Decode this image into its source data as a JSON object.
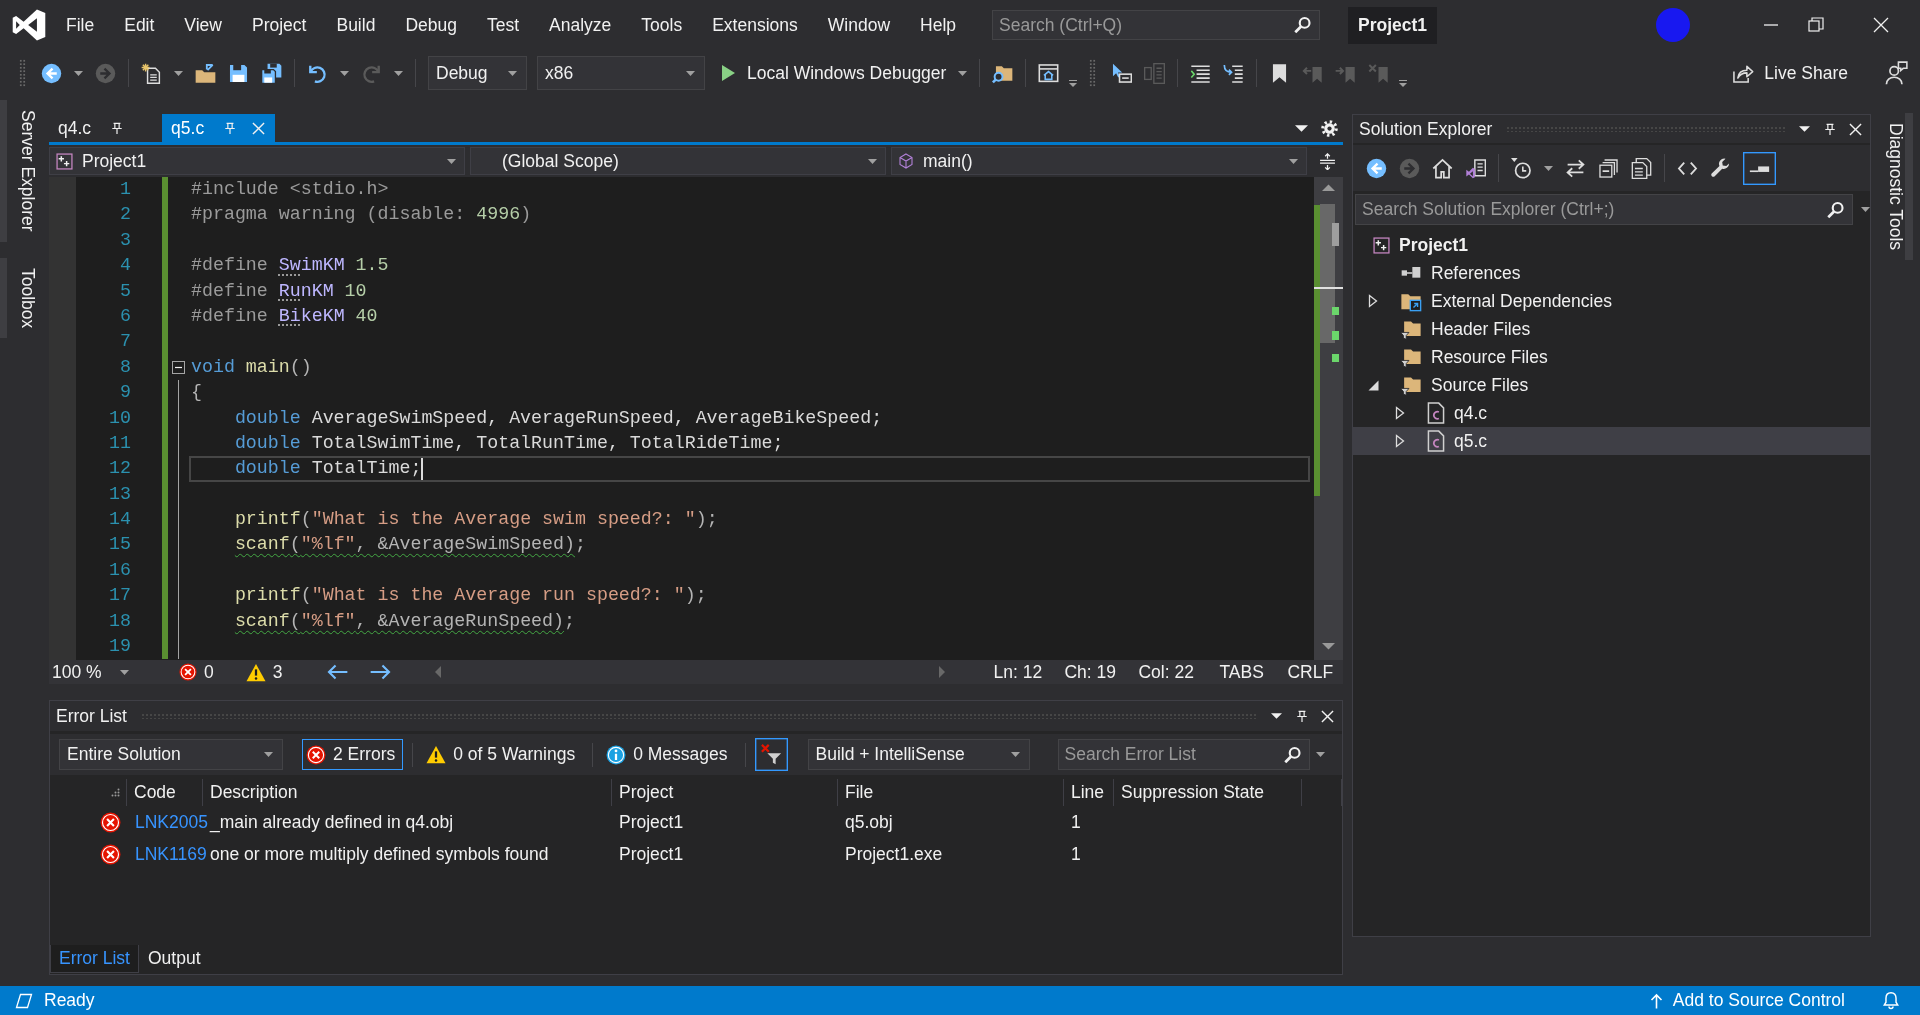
{
  "window": {
    "title": "Project1"
  },
  "menu": [
    "File",
    "Edit",
    "View",
    "Project",
    "Build",
    "Debug",
    "Test",
    "Analyze",
    "Tools",
    "Extensions",
    "Window",
    "Help"
  ],
  "search": {
    "placeholder": "Search (Ctrl+Q)"
  },
  "toolbar": {
    "groups": [
      [
        {
          "kind": "back",
          "disabled": false
        },
        {
          "kind": "forward",
          "disabled": true
        }
      ],
      [
        {
          "kind": "new",
          "disabled": false
        },
        {
          "kind": "open",
          "disabled": false
        },
        {
          "kind": "save",
          "disabled": false
        },
        {
          "kind": "save-all",
          "disabled": false
        }
      ],
      [
        {
          "kind": "undo",
          "disabled": false
        },
        {
          "kind": "redo",
          "disabled": true
        }
      ]
    ],
    "configuration": "Debug",
    "platform": "x86",
    "start": "Local Windows Debugger",
    "tools": [
      [
        {
          "kind": "find",
          "disabled": false
        }
      ],
      [
        {
          "kind": "browse",
          "disabled": false
        }
      ]
    ],
    "editor_tools": [
      [
        {
          "kind": "pointer",
          "disabled": false
        },
        {
          "kind": "panes",
          "disabled": true
        }
      ],
      [
        {
          "kind": "indent",
          "disabled": false
        },
        {
          "kind": "outdent",
          "disabled": false
        }
      ],
      [
        {
          "kind": "bookmark",
          "disabled": false
        },
        {
          "kind": "bookmark-prev",
          "disabled": true
        },
        {
          "kind": "bookmark-next",
          "disabled": true
        },
        {
          "kind": "bookmark-clear",
          "disabled": true
        }
      ]
    ],
    "live_share": "Live Share"
  },
  "left_dock": [
    "Server Explorer",
    "Toolbox"
  ],
  "editor": {
    "tabs": [
      {
        "label": "q4.c",
        "selected": false,
        "pinned": true
      },
      {
        "label": "q5.c",
        "selected": true,
        "pinned": true
      }
    ],
    "navigation": [
      {
        "label": "Project1",
        "kind": "project"
      },
      {
        "label": "(Global Scope)",
        "kind": "scope"
      },
      {
        "label": "main()",
        "kind": "function"
      }
    ],
    "lines": [
      {
        "n": "1",
        "changed": true,
        "tokens": [
          {
            "kind": "pp",
            "text": "#include <stdio.h>"
          }
        ]
      },
      {
        "n": "2",
        "changed": true,
        "tokens": [
          {
            "kind": "pp",
            "text": "#pragma warning (disable: "
          },
          {
            "kind": "num",
            "text": "4996"
          },
          {
            "kind": "pp",
            "text": ")"
          }
        ]
      },
      {
        "n": "3",
        "changed": true
      },
      {
        "n": "4",
        "changed": true,
        "tokens": [
          {
            "kind": "pp",
            "text": "#define "
          },
          {
            "kind": "macro",
            "text": "Sw",
            "hint": true
          },
          {
            "kind": "macro",
            "text": "imKM "
          },
          {
            "kind": "num",
            "text": "1.5"
          }
        ]
      },
      {
        "n": "5",
        "changed": true,
        "tokens": [
          {
            "kind": "pp",
            "text": "#define "
          },
          {
            "kind": "macro",
            "text": "Ru",
            "hint": true
          },
          {
            "kind": "macro",
            "text": "nKM "
          },
          {
            "kind": "num",
            "text": "10"
          }
        ]
      },
      {
        "n": "6",
        "changed": true,
        "tokens": [
          {
            "kind": "pp",
            "text": "#define "
          },
          {
            "kind": "macro",
            "text": "Bi",
            "hint": true
          },
          {
            "kind": "macro",
            "text": "keKM "
          },
          {
            "kind": "num",
            "text": "40"
          }
        ]
      },
      {
        "n": "7",
        "changed": true
      },
      {
        "n": "8",
        "changed": true,
        "fold_start": true,
        "tokens": [
          {
            "kind": "kw",
            "text": "void "
          },
          {
            "kind": "fn",
            "text": "main"
          },
          {
            "kind": "op",
            "text": "()"
          }
        ]
      },
      {
        "n": "9",
        "changed": true,
        "in_fold": true,
        "tokens": [
          {
            "kind": "op",
            "text": "{"
          }
        ]
      },
      {
        "n": "10",
        "changed": true,
        "in_fold": true,
        "indented": true,
        "tokens": [
          {
            "kind": "kw",
            "text": "double "
          },
          {
            "kind": "id",
            "text": "AverageSwimSpeed, AverageRunSpeed, AverageBikeSpeed;"
          }
        ]
      },
      {
        "n": "11",
        "changed": true,
        "in_fold": true,
        "indented": true,
        "tokens": [
          {
            "kind": "kw",
            "text": "double "
          },
          {
            "kind": "id",
            "text": "TotalSwimTime, TotalRunTime, TotalRideTime;"
          }
        ]
      },
      {
        "n": "12",
        "changed": true,
        "in_fold": true,
        "indented": true,
        "current": true,
        "tokens": [
          {
            "kind": "kw",
            "text": "double "
          },
          {
            "kind": "id",
            "text": "TotalTime;"
          }
        ]
      },
      {
        "n": "13",
        "changed": true,
        "in_fold": true
      },
      {
        "n": "14",
        "changed": true,
        "in_fold": true,
        "indented": true,
        "tokens": [
          {
            "kind": "fn",
            "text": "printf"
          },
          {
            "kind": "op",
            "text": "("
          },
          {
            "kind": "str",
            "text": "\"What is the Average swim speed?: \""
          },
          {
            "kind": "op",
            "text": ");"
          }
        ]
      },
      {
        "n": "15",
        "changed": true,
        "in_fold": true,
        "indented": true,
        "tokens": [
          {
            "kind": "fn",
            "text": "scanf",
            "warning": true
          },
          {
            "kind": "op",
            "text": "(",
            "warning": true
          },
          {
            "kind": "str",
            "text": "\"%lf\"",
            "warning": true
          },
          {
            "kind": "op",
            "text": ", &AverageSwimSpeed)",
            "warning": true
          },
          {
            "kind": "op",
            "text": ";"
          }
        ]
      },
      {
        "n": "16",
        "changed": true,
        "in_fold": true
      },
      {
        "n": "17",
        "changed": true,
        "in_fold": true,
        "indented": true,
        "tokens": [
          {
            "kind": "fn",
            "text": "printf"
          },
          {
            "kind": "op",
            "text": "("
          },
          {
            "kind": "str",
            "text": "\"What is the Average run speed?: \""
          },
          {
            "kind": "op",
            "text": ");"
          }
        ]
      },
      {
        "n": "18",
        "changed": true,
        "in_fold": true,
        "indented": true,
        "tokens": [
          {
            "kind": "fn",
            "text": "scanf",
            "warning": true
          },
          {
            "kind": "op",
            "text": "(",
            "warning": true
          },
          {
            "kind": "str",
            "text": "\"%lf\"",
            "warning": true
          },
          {
            "kind": "op",
            "text": ", &AverageRunSpeed)",
            "warning": true
          },
          {
            "kind": "op",
            "text": ";"
          }
        ]
      },
      {
        "n": "19",
        "changed": true,
        "in_fold": true
      }
    ],
    "status": {
      "zoom": "100 %",
      "errors": "0",
      "warnings": "3",
      "line": "Ln: 12",
      "char": "Ch: 19",
      "column": "Col: 22",
      "indentation": "TABS",
      "line_endings": "CRLF"
    }
  },
  "error_list": {
    "title": "Error List",
    "scope": "Entire Solution",
    "filters": [
      {
        "kind": "error",
        "label": "2 Errors",
        "selected": true
      },
      {
        "kind": "warning",
        "label": "0 of 5 Warnings",
        "selected": false
      },
      {
        "kind": "message",
        "label": "0 Messages",
        "selected": false
      }
    ],
    "filter_toggle": {
      "on": true
    },
    "source": "Build + IntelliSense",
    "search": {
      "placeholder": "Search Error List"
    },
    "columns": [
      "Code",
      "Description",
      "Project",
      "File",
      "Line",
      "Suppression State"
    ],
    "rows": [
      {
        "kind": "error",
        "code": "LNK2005",
        "description": "_main already defined in q4.obj",
        "project": "Project1",
        "file": "q5.obj",
        "line": "1"
      },
      {
        "kind": "error",
        "code": "LNK1169",
        "description": "one or more multiply defined symbols found",
        "project": "Project1",
        "file": "Project1.exe",
        "line": "1"
      }
    ],
    "tabs": [
      {
        "label": "Error List",
        "selected": true
      },
      {
        "label": "Output",
        "selected": false
      }
    ]
  },
  "solution_explorer": {
    "title": "Solution Explorer",
    "toolbar": [
      [
        {
          "kind": "back",
          "disabled": false
        },
        {
          "kind": "forward",
          "disabled": true
        },
        {
          "kind": "home",
          "disabled": false
        },
        {
          "kind": "switch-views",
          "disabled": false
        }
      ],
      [
        {
          "kind": "history",
          "disabled": false
        },
        {
          "kind": "sync",
          "disabled": false
        },
        {
          "kind": "collapse-all",
          "disabled": false
        },
        {
          "kind": "show-all",
          "disabled": false
        }
      ],
      [
        {
          "kind": "code",
          "disabled": false
        },
        {
          "kind": "properties",
          "disabled": false
        },
        {
          "kind": "preview",
          "disabled": false,
          "on": true
        }
      ]
    ],
    "search": {
      "placeholder": "Search Solution Explorer (Ctrl+;)"
    },
    "tree": [
      {
        "label": "Project1",
        "kind": "project",
        "selected": false,
        "children": [
          {
            "label": "References",
            "kind": "references",
            "selected": false
          },
          {
            "label": "External Dependencies",
            "kind": "dependencies",
            "expanded": false,
            "selected": false
          },
          {
            "label": "Header Files",
            "kind": "filter",
            "selected": false
          },
          {
            "label": "Resource Files",
            "kind": "filter",
            "selected": false
          },
          {
            "label": "Source Files",
            "kind": "filter",
            "expanded": true,
            "selected": false,
            "children": [
              {
                "label": "q4.c",
                "kind": "file",
                "expanded": false,
                "selected": false
              },
              {
                "label": "q5.c",
                "kind": "file",
                "expanded": false,
                "selected": true
              }
            ]
          }
        ]
      }
    ]
  },
  "right_dock": [
    "Diagnostic Tools"
  ],
  "status_bar": {
    "text": "Ready",
    "source_control": "Add to Source Control"
  }
}
